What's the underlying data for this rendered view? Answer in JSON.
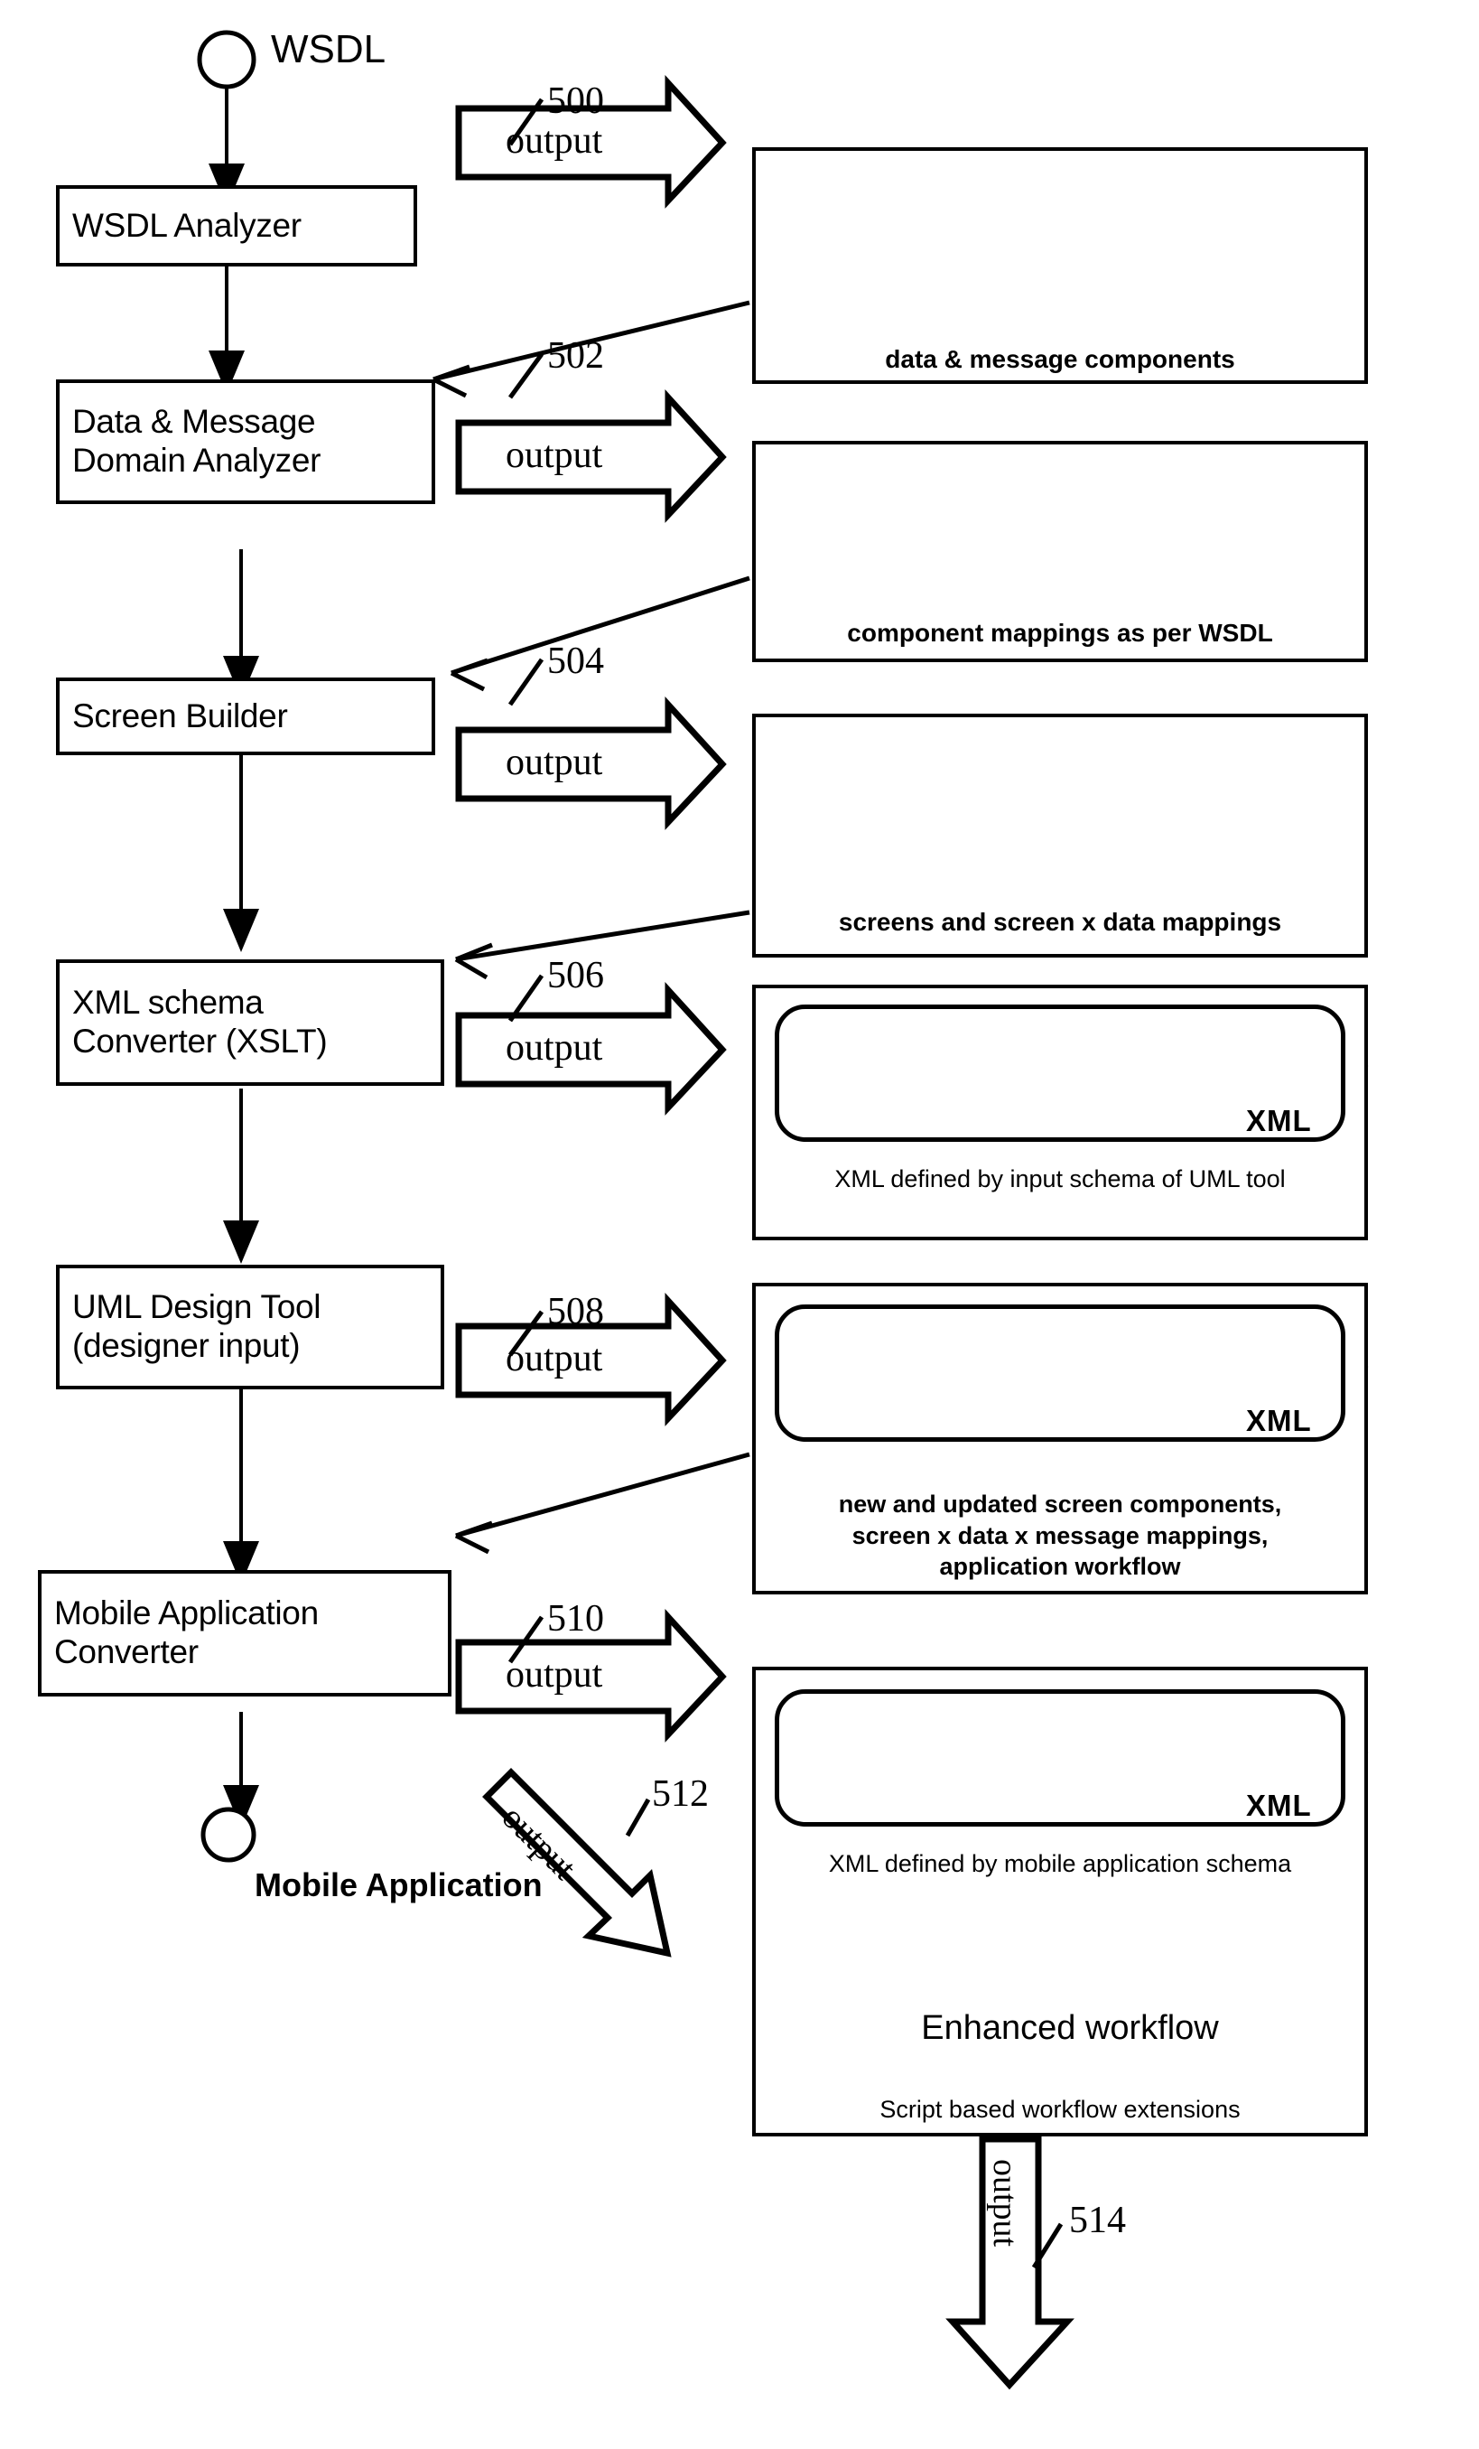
{
  "diagram": {
    "start_node_label": "WSDL",
    "end_node_label": "Mobile Application",
    "process_steps": [
      {
        "id": "wsdl-analyzer",
        "label": "WSDL Analyzer"
      },
      {
        "id": "data-message-domain-analyzer",
        "label": "Data & Message\nDomain Analyzer"
      },
      {
        "id": "screen-builder",
        "label": "Screen Builder"
      },
      {
        "id": "xml-schema-converter",
        "label": "XML schema\nConverter (XSLT)"
      },
      {
        "id": "uml-design-tool",
        "label": "UML Design Tool\n(designer input)"
      },
      {
        "id": "mobile-application-converter",
        "label": "Mobile Application\nConverter"
      }
    ],
    "output_arrows": [
      {
        "id": "output-500",
        "label": "output",
        "ref": "500"
      },
      {
        "id": "output-502",
        "label": "output",
        "ref": "502"
      },
      {
        "id": "output-504",
        "label": "output",
        "ref": "504"
      },
      {
        "id": "output-506",
        "label": "output",
        "ref": "506"
      },
      {
        "id": "output-508",
        "label": "output",
        "ref": "508"
      },
      {
        "id": "output-510",
        "label": "output",
        "ref": "510"
      },
      {
        "id": "output-512",
        "label": "output",
        "ref": "512"
      },
      {
        "id": "output-514",
        "label": "output",
        "ref": "514"
      }
    ],
    "artifact_panels": [
      {
        "id": "panel-data-message-components",
        "caption": "data & message components",
        "icons": [
          "envelope-stack-icon",
          "database-stack-icon"
        ]
      },
      {
        "id": "panel-component-mappings",
        "caption": "component mappings as per WSDL",
        "icons": [
          "envelope-stack-icon",
          "double-arrow-icon",
          "database-stack-icon"
        ]
      },
      {
        "id": "panel-screens-data-mappings",
        "caption": "screens and screen x data mappings",
        "icons": [
          "envelope-stack-icon",
          "screen-stack-icon",
          "double-arrow-icon",
          "database-stack-icon"
        ]
      },
      {
        "id": "panel-xml-uml-input-schema",
        "caption": "XML defined by input schema of UML tool",
        "xml_badge": "XML",
        "icons": [
          "screen-stack-icon",
          "envelope-stack-icon",
          "database-stack-icon",
          "double-arrow-icon"
        ]
      },
      {
        "id": "panel-new-updated-screen-components",
        "caption": "new and updated screen components,\nscreen x data x message mappings,\napplication workflow",
        "xml_badge": "XML",
        "icons": [
          "screen-stack-icon",
          "envelope-stack-icon",
          "database-stack-icon",
          "double-arrow-icon"
        ]
      },
      {
        "id": "panel-mobile-application-schema",
        "caption": "XML defined by mobile application schema",
        "xml_badge": "XML",
        "icons": [
          "screen-stack-icon",
          "envelope-stack-icon",
          "database-stack-icon",
          "double-arrow-icon"
        ],
        "scroll_label": "Enhanced workflow",
        "scroll_caption": "Script based workflow extensions"
      }
    ]
  }
}
